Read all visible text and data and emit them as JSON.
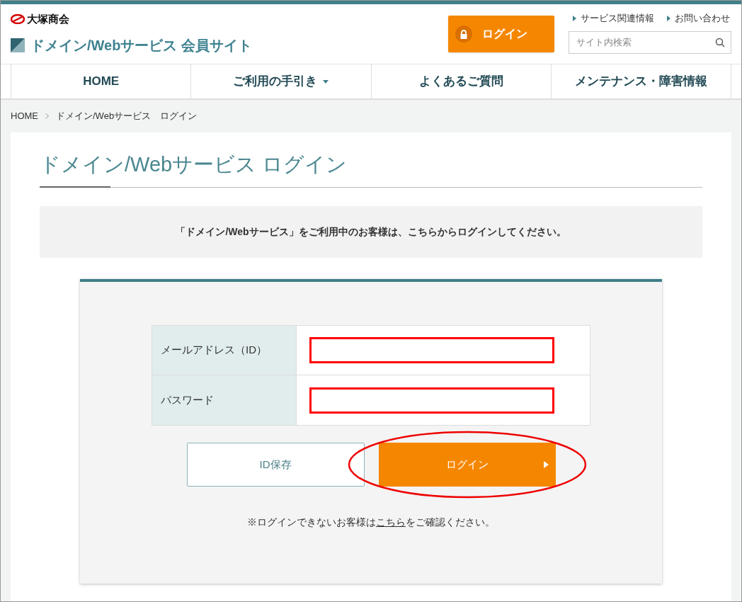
{
  "header": {
    "company": "大塚商会",
    "site_title": "ドメイン/Webサービス 会員サイト",
    "login_button": "ログイン",
    "links": [
      "サービス関連情報",
      "お問い合わせ"
    ],
    "search": {
      "placeholder": "サイト内検索"
    }
  },
  "nav": [
    {
      "label": "HOME",
      "dropdown": false
    },
    {
      "label": "ご利用の手引き",
      "dropdown": true
    },
    {
      "label": "よくあるご質問",
      "dropdown": false
    },
    {
      "label": "メンテナンス・障害情報",
      "dropdown": false
    }
  ],
  "breadcrumb": [
    "HOME",
    "ドメイン/Webサービス　ログイン"
  ],
  "page_title": "ドメイン/Webサービス ログイン",
  "notice": "「ドメイン/Webサービス」をご利用中のお客様は、こちらからログインしてください。",
  "form": {
    "fields": [
      {
        "label": "メールアドレス（ID）",
        "highlighted": true
      },
      {
        "label": "パスワード",
        "highlighted": true
      }
    ],
    "save_button": {
      "label": "ID保存",
      "highlighted": false
    },
    "login_button": {
      "label": "ログイン",
      "highlighted": true
    },
    "note": {
      "before": "※ログインできないお客様は",
      "link": "こちら",
      "after": "をご確認ください。"
    }
  }
}
